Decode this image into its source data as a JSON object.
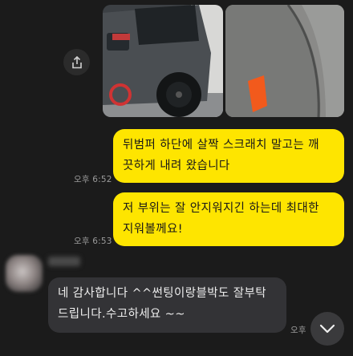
{
  "photo_attachment": {
    "left_alt_icon": "car-rear-photo",
    "right_alt_icon": "scratch-closeup-photo",
    "share_icon": "share-icon"
  },
  "messages": [
    {
      "sender": "me",
      "text": "뒤범퍼 하단에 살짝 스크래치 말고는 깨\n끗하게 내려 왔습니다",
      "time": "오후 6:52"
    },
    {
      "sender": "me",
      "text": "저 부위는 잘 안지워지긴 하는데 최대한\n지워볼께요!",
      "time": "오후 6:53"
    },
    {
      "sender": "other",
      "text": "네 감사합니다 ^^썬팅이랑블박도 잘부탁\n드립니다.수고하세요 ~~",
      "time": "오후"
    }
  ],
  "colors": {
    "my_bubble": "#fee500",
    "their_bubble": "#333336",
    "background": "#1b1b1b"
  },
  "scroll_down_icon": "chevron-down-icon"
}
